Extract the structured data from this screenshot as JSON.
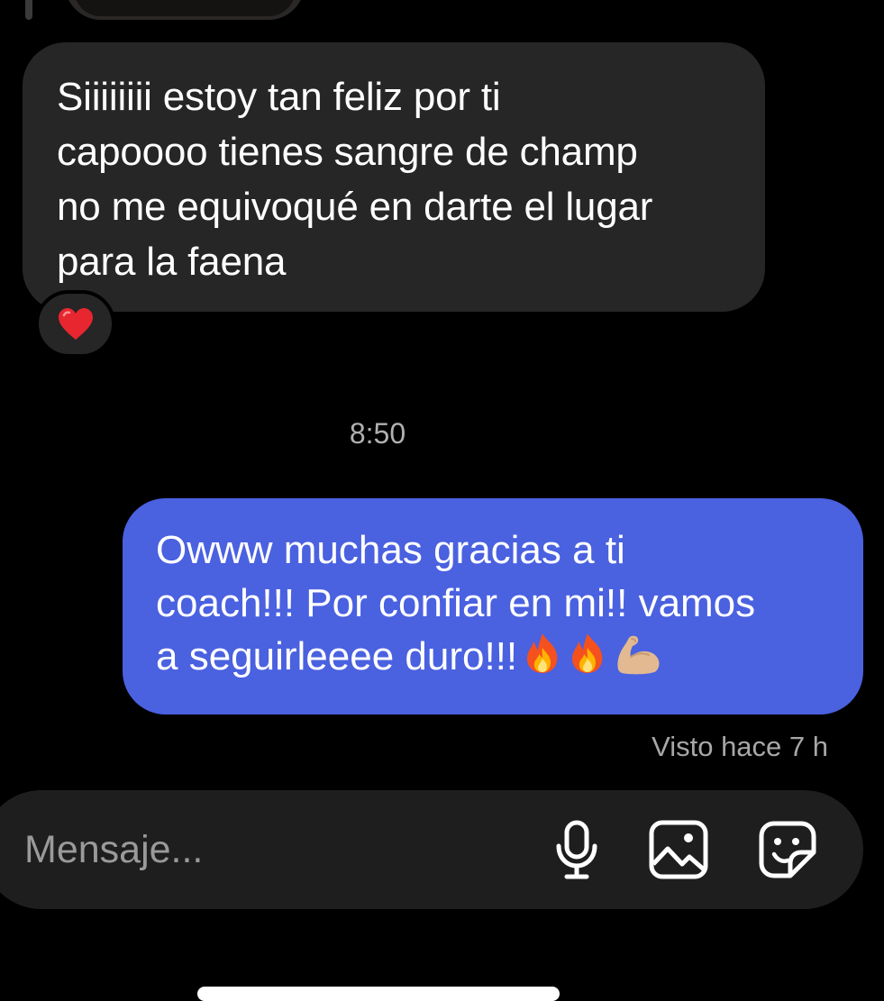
{
  "thread": {
    "incoming_message": {
      "lines": [
        "Siiiiiiii estoy tan feliz por ti",
        "capoooo tienes sangre de champ",
        "no me equivoqué en darte el lugar",
        "para la faena"
      ],
      "reaction": "heart-emoji"
    },
    "timestamp": "8:50",
    "outgoing_message": {
      "lines": [
        "Owww muchas gracias a ti",
        "coach!!! Por confiar en mi!! vamos",
        "a seguirleeee duro!!!"
      ],
      "trailing_emojis": [
        "fire-emoji",
        "fire-emoji",
        "flexed-biceps-emoji"
      ]
    },
    "seen_status": "Visto hace 7 h"
  },
  "composer": {
    "placeholder": "Mensaje...",
    "icons": [
      "microphone-icon",
      "image-icon",
      "sticker-icon"
    ]
  },
  "colors": {
    "background": "#000000",
    "incoming_bubble": "#262626",
    "outgoing_bubble": "#4a61e0",
    "composer": "#1e1e1e",
    "muted_text": "#a7a7a7"
  }
}
